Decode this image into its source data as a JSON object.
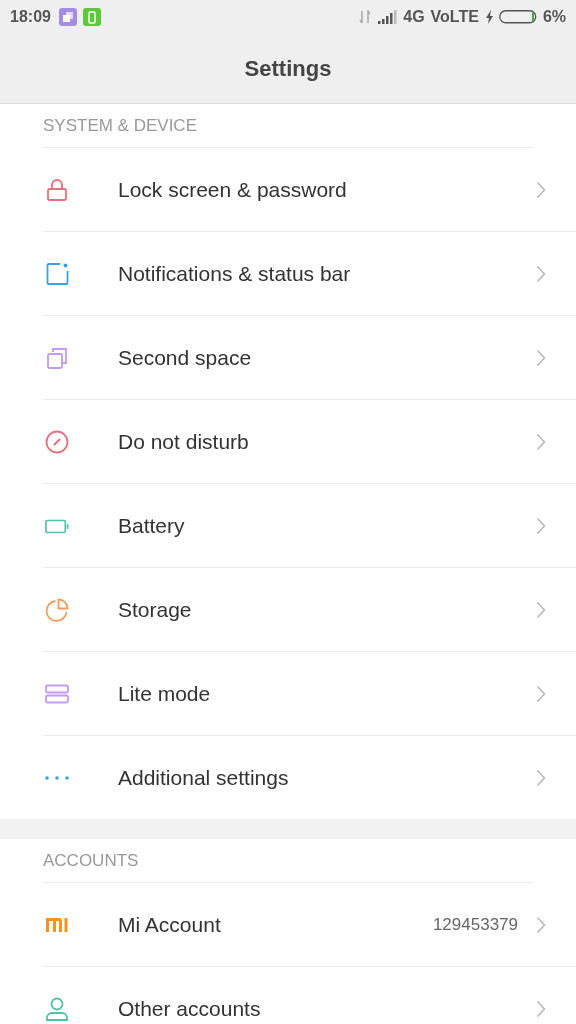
{
  "status_bar": {
    "time": "18:09",
    "network": "4G",
    "volte": "VoLTE",
    "battery": "6%"
  },
  "title": "Settings",
  "sections": [
    {
      "heading": "SYSTEM & DEVICE",
      "items": [
        {
          "label": "Lock screen & password",
          "kind": "lock"
        },
        {
          "label": "Notifications & status bar",
          "kind": "notification"
        },
        {
          "label": "Second space",
          "kind": "copies"
        },
        {
          "label": "Do not disturb",
          "kind": "dnd"
        },
        {
          "label": "Battery",
          "kind": "battery"
        },
        {
          "label": "Storage",
          "kind": "pie"
        },
        {
          "label": "Lite mode",
          "kind": "stack"
        },
        {
          "label": "Additional settings",
          "kind": "dots"
        }
      ]
    },
    {
      "heading": "ACCOUNTS",
      "items": [
        {
          "label": "Mi Account",
          "kind": "mi",
          "value": "129453379"
        },
        {
          "label": "Other accounts",
          "kind": "person"
        }
      ]
    }
  ]
}
